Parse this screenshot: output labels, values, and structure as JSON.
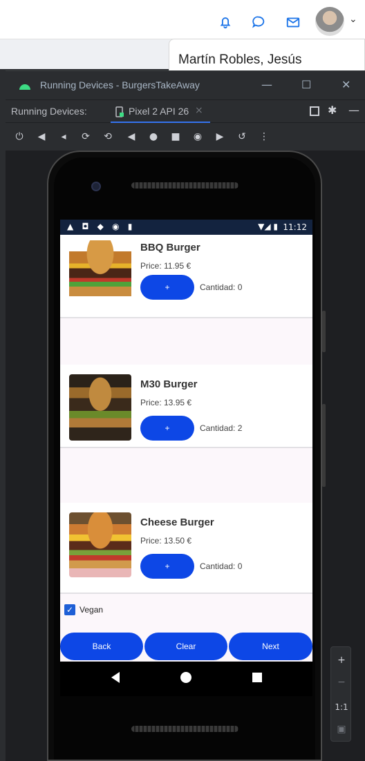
{
  "top": {
    "user_name": "Martín Robles, Jesús",
    "icons": [
      "bell-icon",
      "chat-icon",
      "mail-icon"
    ]
  },
  "window": {
    "title": "Running Devices - BurgersTakeAway",
    "tabs_label": "Running Devices:",
    "device_tab": "Pixel 2 API 26",
    "device_tab_close": "×"
  },
  "phone": {
    "status_time": "11:12",
    "products": [
      {
        "name": "BBQ Burger",
        "price": "Price: 11.95 €",
        "add_label": "+",
        "qty": "Cantidad: 0"
      },
      {
        "name": "M30 Burger",
        "price": "Price: 13.95 €",
        "add_label": "+",
        "qty": "Cantidad: 2"
      },
      {
        "name": "Cheese Burger",
        "price": "Price: 13.50 €",
        "add_label": "+",
        "qty": "Cantidad: 0"
      }
    ],
    "vegan": {
      "label": "Vegan",
      "checked": true
    },
    "buttons": {
      "back": "Back",
      "clear": "Clear",
      "next": "Next"
    }
  },
  "zoom": {
    "in": "+",
    "out": "−",
    "one_to_one": "1:1"
  },
  "colors": {
    "accent": "#0d47e6",
    "ide_bg": "#2b2d30",
    "status_bar": "#13233f"
  }
}
